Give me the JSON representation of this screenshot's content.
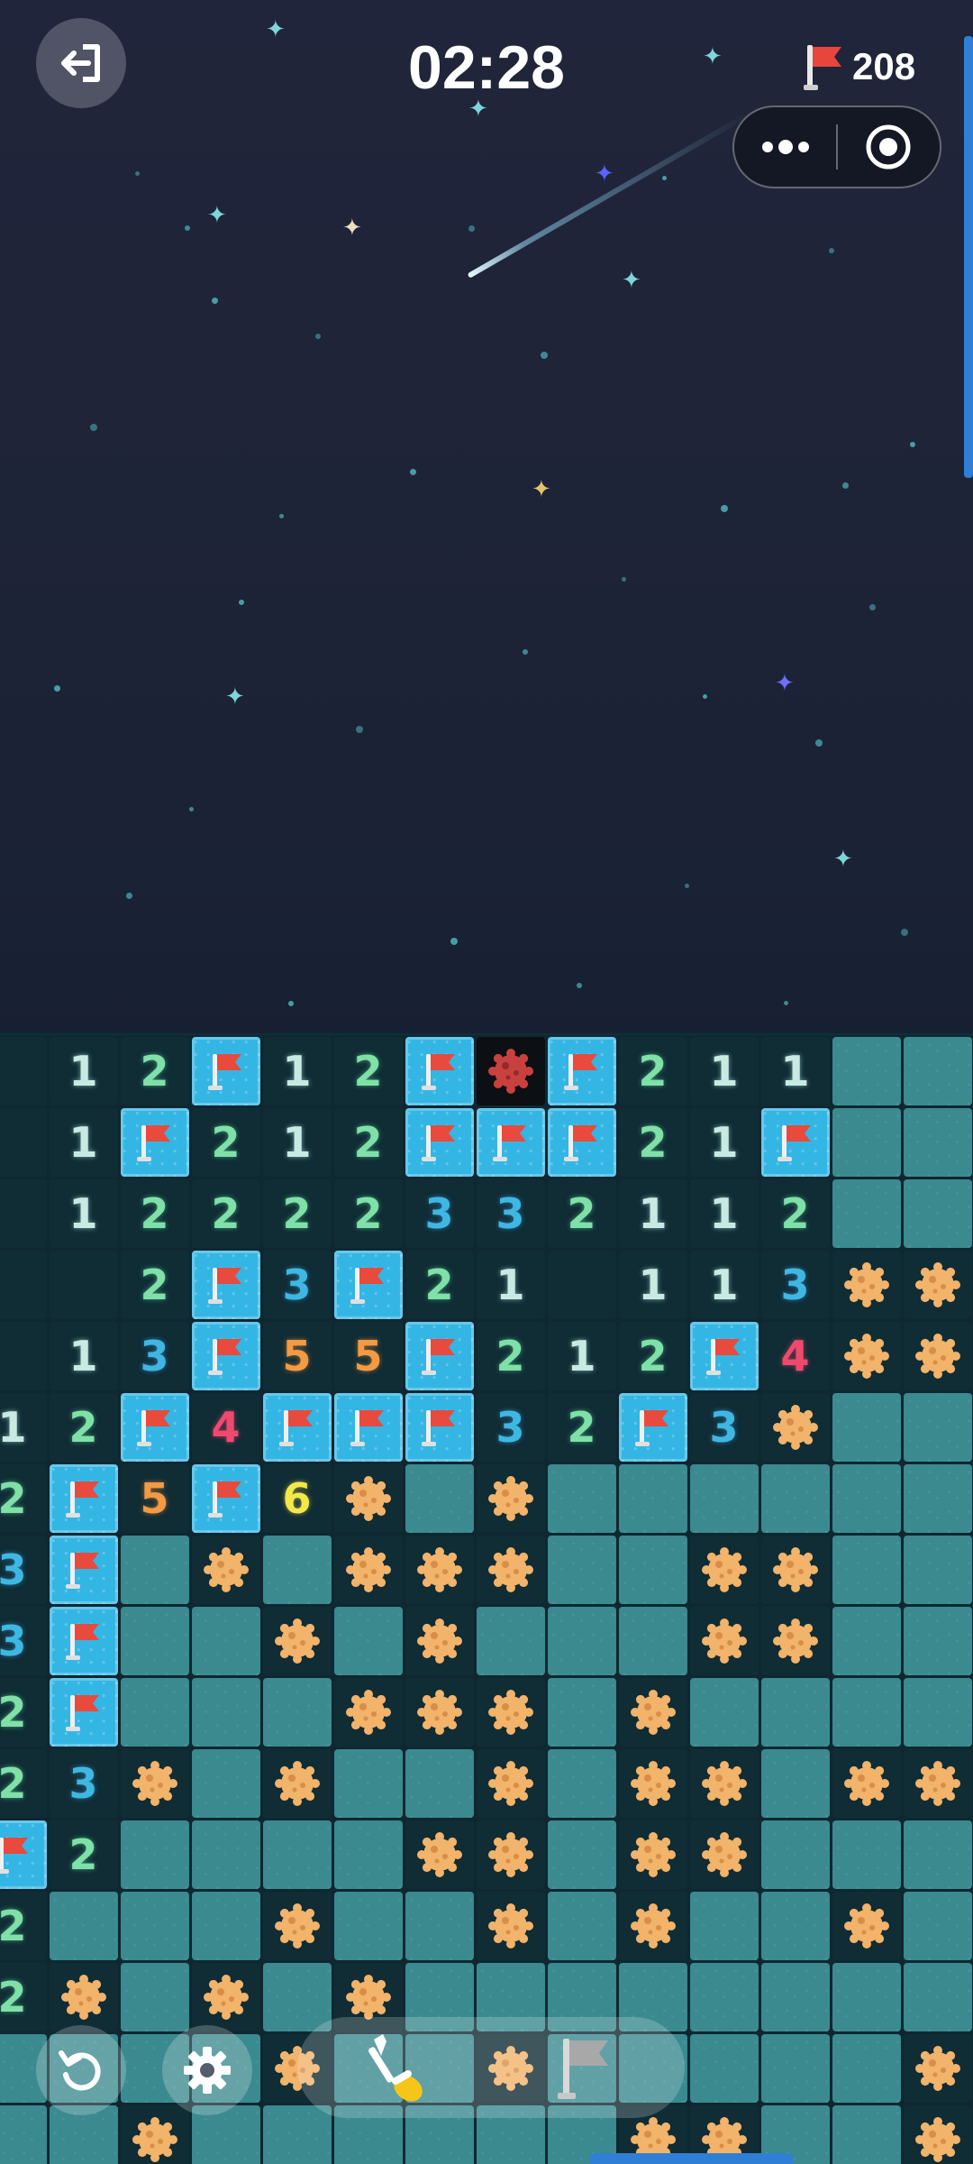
{
  "header": {
    "timer": "02:28",
    "flags_remaining": "208",
    "exit_icon": "exit-icon",
    "flag_icon": "flag-icon",
    "menu_icon": "more-dots-icon",
    "record_icon": "target-icon"
  },
  "colors": {
    "n1": "#c9eae3",
    "n2": "#7fe0a8",
    "n3": "#3fb7e3",
    "n4": "#f0496e",
    "n5": "#f39a42",
    "n6": "#f2e84a",
    "flag_cell": "#34b6e4",
    "hidden_cell": "#3a8a8f",
    "open_cell": "#102c35"
  },
  "board": {
    "legend": "O=open empty, H=hidden, F=flag, M=mine, X=exploded mine, digits=number",
    "rows": [
      "O12F12FXF211HH",
      "O1F212FFF21FHH",
      "O1222233211 2HH",
      "OO2F3F21O113MM",
      "O13F55F212F4MM",
      "12F4FFF32F3MHH",
      "2F5F6MHMHHHHHH",
      "3FHMHMMMHHMMHH",
      "3FHHMHMHHHMMHH",
      "2FHHHMMMHMHHHH",
      "23MHMHHMHMMHMM",
      "F2HHHHMMHMMHHH",
      "2HHHMHHMHMHHMH",
      "2MHMHMHHHHHHHH",
      "HHHHMHHMHHHHHM",
      "HHMHHHHHHMMHHM"
    ]
  },
  "footer": {
    "restart_icon": "restart-icon",
    "settings_icon": "gear-icon",
    "dig_tool_icon": "shovel-icon",
    "flag_tool_icon": "flag-tool-icon"
  }
}
